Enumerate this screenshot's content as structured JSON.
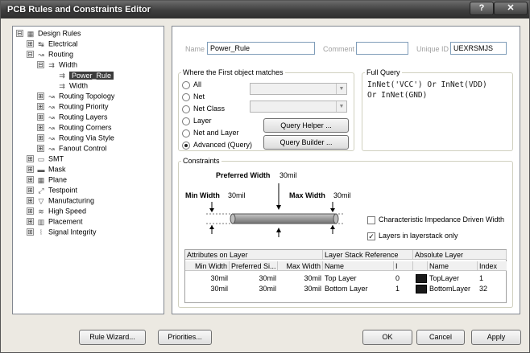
{
  "window": {
    "title": "PCB Rules and Constraints Editor",
    "help_label": "?",
    "close_label": "✕"
  },
  "tree": [
    {
      "label": "Design Rules",
      "exp": "⊟",
      "icon": "▦"
    },
    {
      "label": "Electrical",
      "exp": "⊞",
      "icon": "↹"
    },
    {
      "label": "Routing",
      "exp": "⊟",
      "icon": "↝"
    },
    {
      "label": "Width",
      "exp": "⊟",
      "icon": "⇉"
    },
    {
      "label": "Power_Rule",
      "exp": "",
      "icon": "⇉"
    },
    {
      "label": "Width",
      "exp": "",
      "icon": "⇉"
    },
    {
      "label": "Routing Topology",
      "exp": "⊞",
      "icon": "↝"
    },
    {
      "label": "Routing Priority",
      "exp": "⊞",
      "icon": "↝"
    },
    {
      "label": "Routing Layers",
      "exp": "⊞",
      "icon": "↝"
    },
    {
      "label": "Routing Corners",
      "exp": "⊞",
      "icon": "↝"
    },
    {
      "label": "Routing Via Style",
      "exp": "⊞",
      "icon": "↝"
    },
    {
      "label": "Fanout Control",
      "exp": "⊞",
      "icon": "↝"
    },
    {
      "label": "SMT",
      "exp": "⊞",
      "icon": "▭"
    },
    {
      "label": "Mask",
      "exp": "⊞",
      "icon": "▬"
    },
    {
      "label": "Plane",
      "exp": "⊞",
      "icon": "▦"
    },
    {
      "label": "Testpoint",
      "exp": "⊞",
      "icon": "⤢"
    },
    {
      "label": "Manufacturing",
      "exp": "⊞",
      "icon": "▽"
    },
    {
      "label": "High Speed",
      "exp": "⊞",
      "icon": "≋"
    },
    {
      "label": "Placement",
      "exp": "⊞",
      "icon": "▥"
    },
    {
      "label": "Signal Integrity",
      "exp": "⊞",
      "icon": "⦚"
    }
  ],
  "header": {
    "name_label": "Name",
    "name_value": "Power_Rule",
    "comment_label": "Comment",
    "comment_value": "",
    "uid_label": "Unique ID",
    "uid_value": "UEXRSMJS"
  },
  "match": {
    "title": "Where the First object matches",
    "options": [
      "All",
      "Net",
      "Net Class",
      "Layer",
      "Net and Layer",
      "Advanced (Query)"
    ],
    "selected": "Advanced (Query)",
    "query_helper": "Query Helper ...",
    "query_builder": "Query Builder ..."
  },
  "full_query": {
    "title": "Full Query",
    "lines": [
      "InNet('VCC') Or InNet(VDD)",
      "Or InNet(GND)"
    ]
  },
  "constraints": {
    "title": "Constraints",
    "preferred_label": "Preferred Width",
    "preferred_value": "30mil",
    "min_label": "Min Width",
    "min_value": "30mil",
    "max_label": "Max Width",
    "max_value": "30mil",
    "impedance_label": "Characteristic Impedance Driven Width",
    "impedance_checked": false,
    "layerstack_label": "Layers in layerstack only",
    "layerstack_checked": true
  },
  "grid": {
    "group_headers": [
      "Attributes on Layer",
      "Layer Stack Reference",
      "Absolute Layer"
    ],
    "columns": [
      "Min Width",
      "Preferred Si...",
      "Max Width",
      "Name",
      "I",
      "Name",
      "Index"
    ],
    "rows": [
      [
        "30mil",
        "30mil",
        "30mil",
        "Top Layer",
        "0",
        "TopLayer",
        "1"
      ],
      [
        "30mil",
        "30mil",
        "30mil",
        "Bottom Layer",
        "1",
        "BottomLayer",
        "32"
      ]
    ]
  },
  "footer": {
    "rule_wizard": "Rule Wizard...",
    "priorities": "Priorities...",
    "ok": "OK",
    "cancel": "Cancel",
    "apply": "Apply"
  }
}
